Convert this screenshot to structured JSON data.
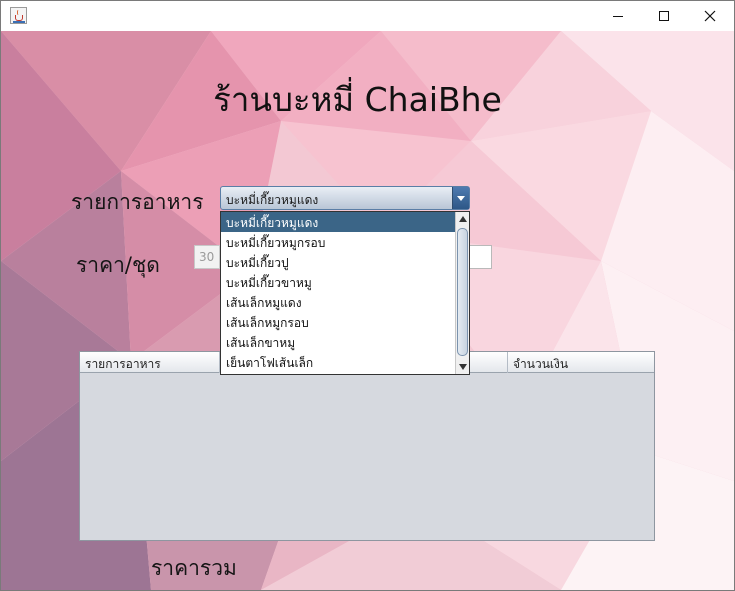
{
  "window": {
    "app_icon": "java-cup-icon",
    "controls": [
      "minimize-icon",
      "maximize-icon",
      "close-icon"
    ]
  },
  "heading": "ร้านบะหมี่ ChaiBhe",
  "form": {
    "food_label": "รายการอาหาร",
    "price_label": "ราคา/ชุด",
    "total_label": "ราคารวม",
    "food_selected": "บะหมี่เกี๊ยวหมูแดง",
    "quantity_value": "30"
  },
  "dropdown": {
    "selected_index": 0,
    "options": [
      "บะหมี่เกี๊ยวหมูแดง",
      "บะหมี่เกี๊ยวหมูกรอบ",
      "บะหมี่เกี๊ยวปู",
      "บะหมี่เกี๊ยวขาหมู",
      "เส้นเล็กหมูแดง",
      "เส้นเล็กหมูกรอบ",
      "เส้นเล็กขาหมู",
      "เย็นตาโฟเส้นเล็ก"
    ]
  },
  "table": {
    "columns": [
      "รายการอาหาร",
      "",
      "",
      "จำนวนเงิน"
    ]
  },
  "colors": {
    "selection": "#3b6587",
    "background_pink": "#f1b3c4"
  }
}
